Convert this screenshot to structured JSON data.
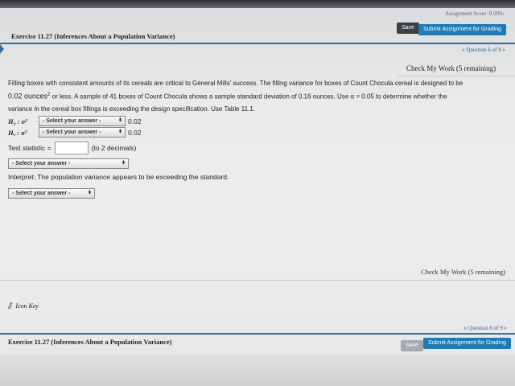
{
  "header": {
    "assignment_score": "Assignment Score: 0.00%",
    "save_label": "Save",
    "submit_label": "Submit Assignment for Grading"
  },
  "exercise": {
    "title": "Exercise 11.27 (Inferences About a Population Variance)"
  },
  "question_nav": {
    "label": "« Question 6 of 9 »"
  },
  "check_my_work": {
    "label": "Check My Work (5 remaining)"
  },
  "problem": {
    "text_1": "Filling boxes with consistent amounts of its cereals are critical to General Mills' success. The filling variance for boxes of Count Chocula cereal is designed to be",
    "text_2": "0.02 ounces",
    "text_2_sup": "2",
    "text_3": " or less. A sample of 41 boxes of Count Chocula shows a sample standard deviation of 0.16 ounces. Use α = 0.05 to determine whether the",
    "text_4": "variance in the cereal box fillings is exceeding the design specification. Use Table 11.1."
  },
  "hypotheses": {
    "h0_label": "H₀ : σ²",
    "ha_label": "Hₐ : σ²",
    "h0_select": "- Select your answer -",
    "ha_select": "- Select your answer -",
    "h0_value": "0.02",
    "ha_value": "0.02"
  },
  "test_statistic": {
    "label": "Test statistic =",
    "value": "",
    "hint": "(to 2 decimals)"
  },
  "select_1": "- Select your answer -",
  "interpret": {
    "text": "Interpret: The population variance appears to be exceeding the standard."
  },
  "select_2": "- Select your answer -",
  "icon_key": {
    "label": "Icon Key"
  },
  "footer": {
    "question_nav": "« Question 6 of 9 »",
    "exercise_title": "Exercise 11.27 (Inferences About a Population Variance)",
    "save_label": "Save",
    "submit_label": "Submit Assignment for Grading"
  },
  "colors": {
    "accent": "#2f6ea6",
    "submit": "#1f7bb4",
    "save": "#3b3e44"
  }
}
